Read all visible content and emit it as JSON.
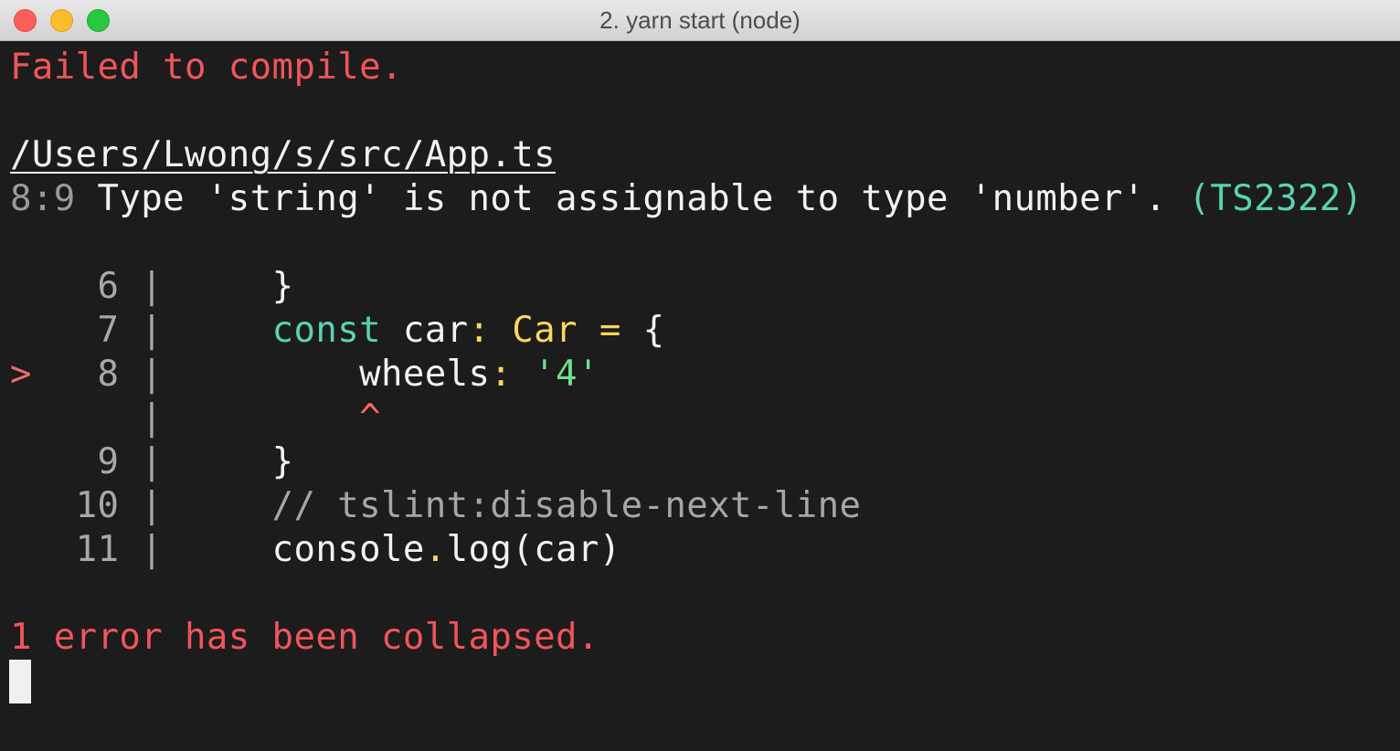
{
  "window": {
    "title": "2. yarn start (node)"
  },
  "terminal": {
    "failed": "Failed to compile.",
    "file_path": "/Users/Lwong/s/src/App.ts",
    "error": {
      "location": "8:9",
      "message": "Type 'string' is not assignable to type 'number'.",
      "code": "(TS2322)"
    },
    "code_frame": [
      {
        "marker": "",
        "lineno": "6",
        "sep": "|",
        "indent": "    ",
        "tokens": [
          {
            "t": "}",
            "c": "white"
          }
        ]
      },
      {
        "marker": "",
        "lineno": "7",
        "sep": "|",
        "indent": "    ",
        "tokens": [
          {
            "t": "const",
            "c": "cyan"
          },
          {
            "t": " car",
            "c": "white"
          },
          {
            "t": ":",
            "c": "yellow"
          },
          {
            "t": " Car",
            "c": "yellow"
          },
          {
            "t": " =",
            "c": "yellow"
          },
          {
            "t": " {",
            "c": "white"
          }
        ]
      },
      {
        "marker": ">",
        "lineno": "8",
        "sep": "|",
        "indent": "        ",
        "tokens": [
          {
            "t": "wheels",
            "c": "white"
          },
          {
            "t": ":",
            "c": "yellow"
          },
          {
            "t": " '4'",
            "c": "green"
          }
        ]
      },
      {
        "marker": "",
        "lineno": "",
        "sep": "|",
        "indent": "        ",
        "tokens": [
          {
            "t": "^",
            "c": "redsoft"
          }
        ]
      },
      {
        "marker": "",
        "lineno": "9",
        "sep": "|",
        "indent": "    ",
        "tokens": [
          {
            "t": "}",
            "c": "white"
          }
        ]
      },
      {
        "marker": "",
        "lineno": "10",
        "sep": "|",
        "indent": "    ",
        "tokens": [
          {
            "t": "// tslint:disable-next-line",
            "c": "comment"
          }
        ]
      },
      {
        "marker": "",
        "lineno": "11",
        "sep": "|",
        "indent": "    ",
        "tokens": [
          {
            "t": "console",
            "c": "white"
          },
          {
            "t": ".",
            "c": "yellow"
          },
          {
            "t": "log(car)",
            "c": "white"
          }
        ]
      }
    ],
    "collapsed": "1 error has been collapsed."
  },
  "colors": {
    "background": "#1c1c1c",
    "error_red": "#f0555a",
    "cyan": "#59d3b1",
    "yellow": "#f8d85b",
    "green": "#6fe08d"
  }
}
